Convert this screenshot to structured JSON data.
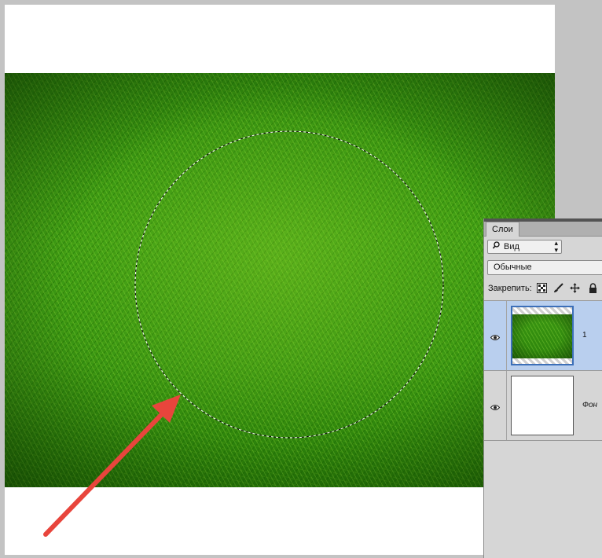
{
  "canvas": {
    "image_description": "grass"
  },
  "layers_panel": {
    "tab_label": "Слои",
    "filter_select": {
      "icon": "search-icon",
      "value": "Вид"
    },
    "blend_mode": "Обычные",
    "lock_label": "Закрепить:",
    "lock_icons": [
      "lock-transparent-icon",
      "brush-icon",
      "move-icon",
      "lock-icon"
    ],
    "layers": [
      {
        "name": "1",
        "visible": true,
        "selected": true,
        "thumbnail": "grass"
      },
      {
        "name": "Фон",
        "visible": true,
        "selected": false,
        "thumbnail": "white"
      }
    ]
  },
  "colors": {
    "arrow": "#e8453c",
    "selection_highlight": "#b9cfee",
    "panel_bg": "#d6d6d6",
    "workspace_bg": "#c3c3c3"
  }
}
